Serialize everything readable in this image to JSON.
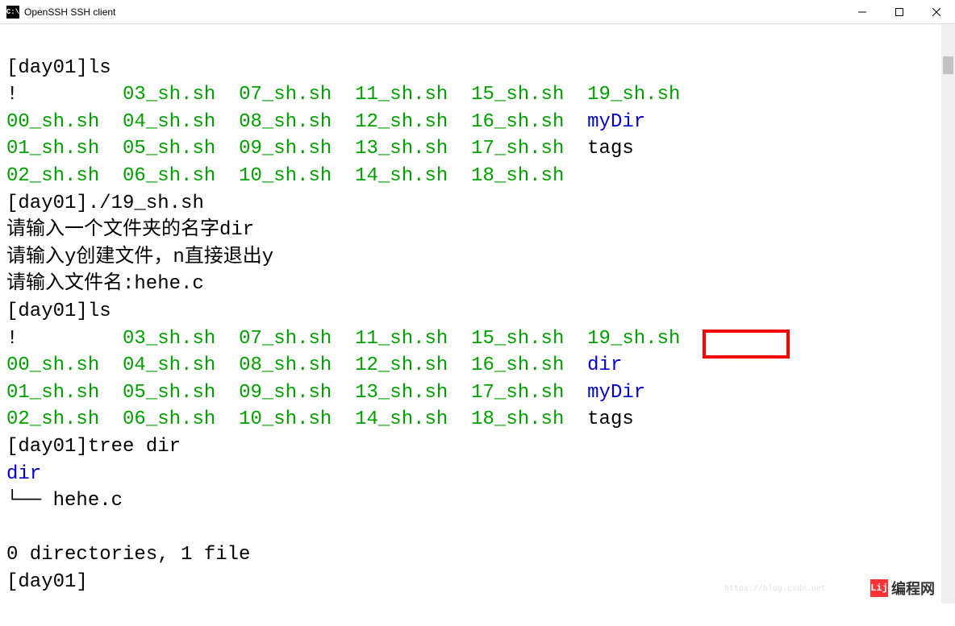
{
  "titlebar": {
    "icon_text": "C:\\",
    "title": "OpenSSH SSH client"
  },
  "terminal": {
    "prompt1": "[day01]ls",
    "ls1": {
      "r1c1": "!",
      "r1c2": "03_sh.sh",
      "r1c3": "07_sh.sh",
      "r1c4": "11_sh.sh",
      "r1c5": "15_sh.sh",
      "r1c6": "19_sh.sh",
      "r2c1": "00_sh.sh",
      "r2c2": "04_sh.sh",
      "r2c3": "08_sh.sh",
      "r2c4": "12_sh.sh",
      "r2c5": "16_sh.sh",
      "r2c6": "myDir",
      "r3c1": "01_sh.sh",
      "r3c2": "05_sh.sh",
      "r3c3": "09_sh.sh",
      "r3c4": "13_sh.sh",
      "r3c5": "17_sh.sh",
      "r3c6": "tags",
      "r4c1": "02_sh.sh",
      "r4c2": "06_sh.sh",
      "r4c3": "10_sh.sh",
      "r4c4": "14_sh.sh",
      "r4c5": "18_sh.sh"
    },
    "prompt2": "[day01]./19_sh.sh",
    "line_input_dir": "请输入一个文件夹的名字dir",
    "line_input_yn": "请输入y创建文件，n直接退出y",
    "line_input_file": "请输入文件名:hehe.c",
    "prompt3": "[day01]ls",
    "ls2": {
      "r1c1": "!",
      "r1c2": "03_sh.sh",
      "r1c3": "07_sh.sh",
      "r1c4": "11_sh.sh",
      "r1c5": "15_sh.sh",
      "r1c6": "19_sh.sh",
      "r2c1": "00_sh.sh",
      "r2c2": "04_sh.sh",
      "r2c3": "08_sh.sh",
      "r2c4": "12_sh.sh",
      "r2c5": "16_sh.sh",
      "r2c6": "dir",
      "r3c1": "01_sh.sh",
      "r3c2": "05_sh.sh",
      "r3c3": "09_sh.sh",
      "r3c4": "13_sh.sh",
      "r3c5": "17_sh.sh",
      "r3c6": "myDir",
      "r4c1": "02_sh.sh",
      "r4c2": "06_sh.sh",
      "r4c3": "10_sh.sh",
      "r4c4": "14_sh.sh",
      "r4c5": "18_sh.sh",
      "r4c6": "tags"
    },
    "prompt4": "[day01]tree dir",
    "tree_root": "dir",
    "tree_branch": "└── hehe.c",
    "tree_summary": "0 directories, 1 file",
    "prompt5": "[day01]"
  },
  "watermark": {
    "logo": "Lij",
    "text": "编程网",
    "url": "https://blog.csdn.net"
  }
}
